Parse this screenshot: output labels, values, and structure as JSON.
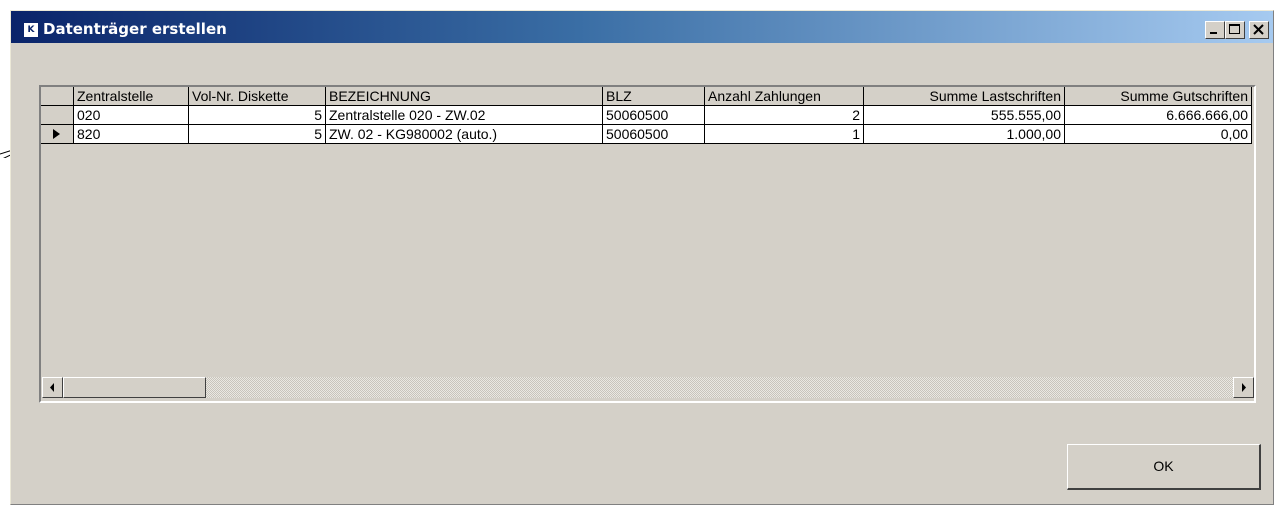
{
  "window": {
    "title": "Datenträger erstellen",
    "icon_label": "K",
    "buttons": [
      "minimize-icon",
      "maximize-icon",
      "close-icon"
    ]
  },
  "grid": {
    "columns": [
      "Zentralstelle",
      "Vol-Nr. Diskette",
      "BEZEICHNUNG",
      "BLZ",
      "Anzahl Zahlungen",
      "Summe Lastschriften",
      "Summe Gutschriften"
    ],
    "rows": [
      [
        "020",
        "5",
        "Zentralstelle 020 - ZW.02",
        "50060500",
        "2",
        "555.555,00",
        "6.666.666,00"
      ],
      [
        "820",
        "5",
        "ZW. 02 - KG980002 (auto.)",
        "50060500",
        "1",
        "1.000,00",
        "0,00"
      ]
    ],
    "current_row": 1
  },
  "ok_button": {
    "label": "OK"
  },
  "colors": {
    "title_start": "#0a246a",
    "title_end": "#a6caf0",
    "face": "#d4d0c8"
  }
}
